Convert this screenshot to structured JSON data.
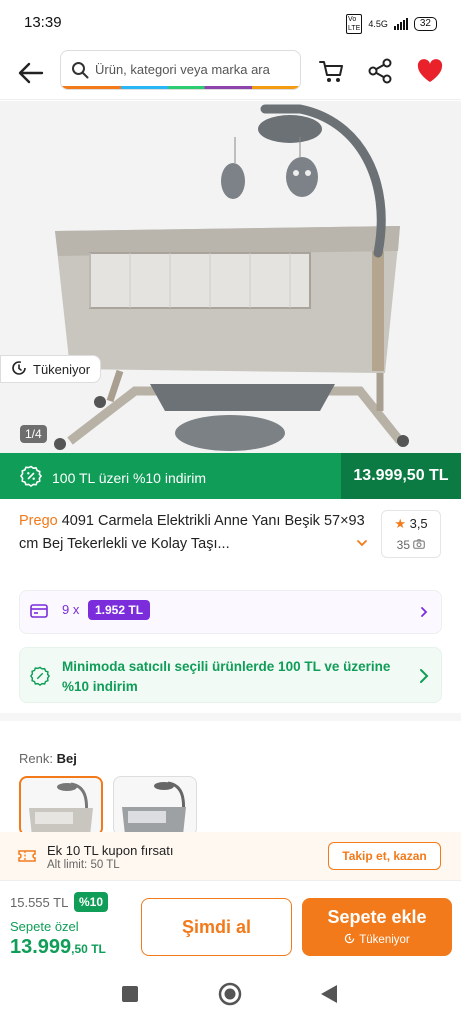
{
  "status_bar": {
    "time": "13:39",
    "network": "4.5G",
    "battery": "32"
  },
  "header": {
    "search_placeholder": "Ürün, kategori veya marka ara",
    "icons": [
      "back-arrow-icon",
      "search-icon",
      "cart-icon",
      "share-icon",
      "heart-icon"
    ],
    "heart_color": "#e8212b"
  },
  "gallery": {
    "stock_chip": "Tükeniyor",
    "pager": "1/4"
  },
  "promo": {
    "text": "100 TL üzeri %10 indirim",
    "price": "13.999,50 TL",
    "color": "#0f9d58"
  },
  "product": {
    "brand": "Prego",
    "title": "4091 Carmela Elektrikli Anne Yanı Beşik 57×93 cm Bej Tekerlekli ve Kolay Taşı...",
    "rating": "3,5",
    "photo_review_count": "35"
  },
  "installment": {
    "count": "9 x",
    "amount": "1.952 TL"
  },
  "seller_promo": {
    "text": "Minimoda satıcılı seçili ürünlerde 100 TL ve üzerine %10 indirim"
  },
  "color_selector": {
    "label": "Renk:",
    "value": "Bej",
    "selected_index": 0
  },
  "coupon": {
    "title": "Ek 10 TL kupon fırsatı",
    "subtitle": "Alt limit: 50 TL",
    "button": "Takip et, kazan"
  },
  "bottom_bar": {
    "old_price": "15.555 TL",
    "discount_badge": "%10",
    "special_label": "Sepete özel",
    "price_main": "13.999",
    "price_cents": ",50 TL",
    "buy_now": "Şimdi al",
    "add_to_cart": "Sepete ekle",
    "add_to_cart_sub": "Tükeniyor"
  },
  "colors": {
    "accent": "#f27a1a",
    "green": "#0f9d58",
    "purple": "#7b2ddc"
  }
}
